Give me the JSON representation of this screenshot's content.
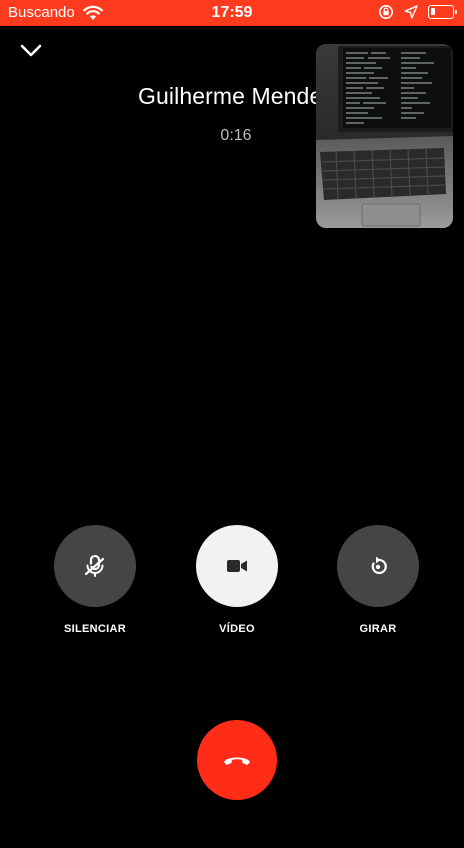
{
  "status_bar": {
    "carrier": "Buscando",
    "time": "17:59",
    "color": "#ff3b1f",
    "icons": [
      "wifi-icon",
      "orientation-lock-icon",
      "location-arrow-icon",
      "battery-icon"
    ]
  },
  "call": {
    "caller_name": "Guilherme Mendes",
    "duration": "0:16"
  },
  "controls": {
    "mute_label": "SILENCIAR",
    "video_label": "VÍDEO",
    "rotate_label": "GIRAR"
  },
  "colors": {
    "control_bg": "#454545",
    "control_active_bg": "#f2f2f2",
    "end_call": "#ff2d18"
  }
}
